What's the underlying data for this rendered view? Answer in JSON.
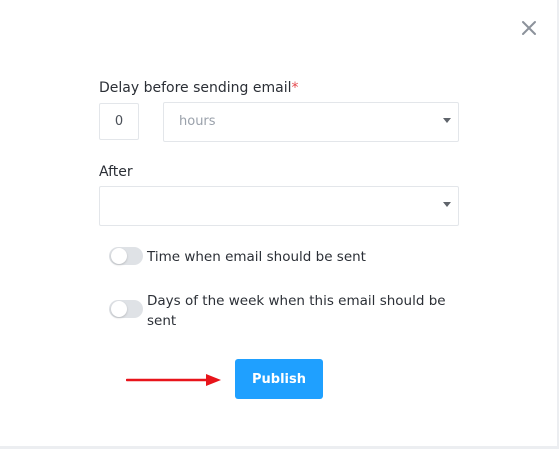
{
  "dialog": {
    "close_label": "×"
  },
  "delay": {
    "label": "Delay before sending email",
    "required_mark": "*",
    "amount_value": "0",
    "unit_value": "hours"
  },
  "after": {
    "label": "After",
    "value": ""
  },
  "toggles": {
    "time_label": "Time when email should be sent",
    "time_on": false,
    "days_label": "Days of the week when this email should be sent",
    "days_on": false
  },
  "actions": {
    "publish_label": "Publish"
  },
  "colors": {
    "primary": "#1fa0ff",
    "annotation_arrow": "#e8141b",
    "required": "#e5484d"
  },
  "icons": {
    "close": "close-icon",
    "caret": "caret-down-icon",
    "annotation": "arrow-right-icon"
  }
}
